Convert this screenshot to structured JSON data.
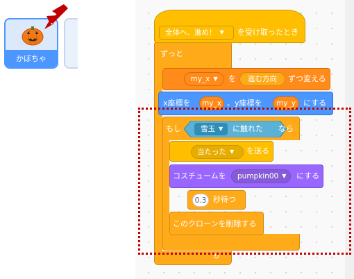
{
  "sprite": {
    "name": "かぼちゃ",
    "selected": true,
    "thumb_icon": "pumpkin-icon",
    "accent": "#4c97ff"
  },
  "annotation": {
    "arrow_icon": "pointer-arrow-icon",
    "arrow_color": "#cc0000",
    "highlight_color": "#c00000"
  },
  "script": {
    "hat": {
      "label": "を受け取ったとき",
      "message": "全体へ、進め！"
    },
    "forever": {
      "label": "ずっと"
    },
    "change_var": {
      "var": "my_x",
      "by_label": "を",
      "reporter": "進む方向",
      "suffix": "ずつ変える"
    },
    "goto_xy": {
      "x_label": "x座標を",
      "x_var": "my_x",
      "y_label": "、y座標を",
      "y_var": "my_y",
      "suffix": "にする"
    },
    "if_block": {
      "if_label": "もし",
      "target": "雪玉",
      "touching_label": "に触れた",
      "then_label": "なら"
    },
    "broadcast": {
      "message": "当たった",
      "label": "を送る"
    },
    "costume": {
      "label": "コスチュームを",
      "costume": "pumpkin00",
      "suffix": "にする"
    },
    "wait": {
      "seconds": "0.3",
      "label": "秒待つ"
    },
    "delete_clone": {
      "label": "このクローンを削除する"
    }
  }
}
